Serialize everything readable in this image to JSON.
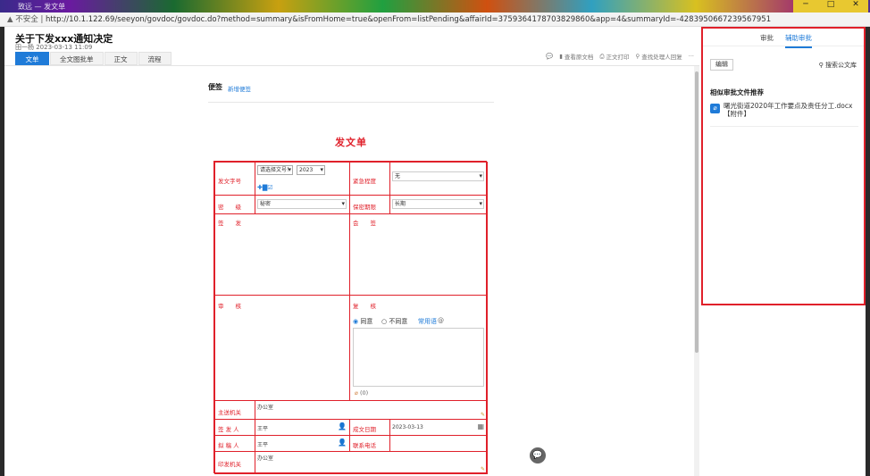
{
  "window": {
    "title": "致远 — 发文单",
    "url_prefix": "不安全 | ",
    "url": "http://10.1.122.69/seeyon/govdoc/govdoc.do?method=summary&isFromHome=true&openFrom=listPending&affairId=3759364178703829860&app=4&summaryId=-4283950667239567951"
  },
  "header": {
    "title": "关于下发xxx通知决定",
    "meta": "田一杨 2023-03-13 11:09",
    "tabs": [
      {
        "label": "文单",
        "active": true
      },
      {
        "label": "全文图批单"
      },
      {
        "label": "正文"
      },
      {
        "label": "流程"
      }
    ],
    "tools": [
      "查看原文档",
      "正文打印",
      "查找处理人回复"
    ]
  },
  "note": {
    "label": "便签",
    "add": "新增便签"
  },
  "form": {
    "title": "发文单",
    "doc_no_label": "发文字号",
    "doc_no_select": "请选择文号！",
    "doc_year": "2023",
    "urgency_label": "紧急程度",
    "urgency_value": "无",
    "secret_label": "密　　级",
    "secret_value": "秘密",
    "keep_label": "保密期限",
    "keep_value": "长期",
    "sign_label": "签　　发",
    "countersign_label": "会　　签",
    "review_label": "审　　核",
    "recheck_label": "复　　核",
    "agree": "同意",
    "disagree": "不同意",
    "common_phrase": "常用语",
    "attach_count": "(0)",
    "issuer_label": "主送机关",
    "issuer_value": "办公室",
    "signer_label": "签 发 人",
    "signer_value": "王平",
    "issue_date_label": "成文日期",
    "issue_date_value": "2023-03-13",
    "drafter_label": "拟 稿 人",
    "drafter_value": "王平",
    "phone_label": "联系电话",
    "phone_value": "",
    "cc_label": "印发机关",
    "cc_value": "办公室"
  },
  "sidebar": {
    "tabs": [
      {
        "label": "审批"
      },
      {
        "label": "辅助审批",
        "active": true
      }
    ],
    "edit": "编辑",
    "search": "搜索公文库",
    "section": "相似审批文件推荐",
    "items": [
      {
        "name": "曙光街道2020年工作要点及责任分工.docx",
        "tag": "【附件】"
      }
    ]
  },
  "colors": {
    "accent": "#1f7bd8",
    "form_red": "#e0202a"
  }
}
